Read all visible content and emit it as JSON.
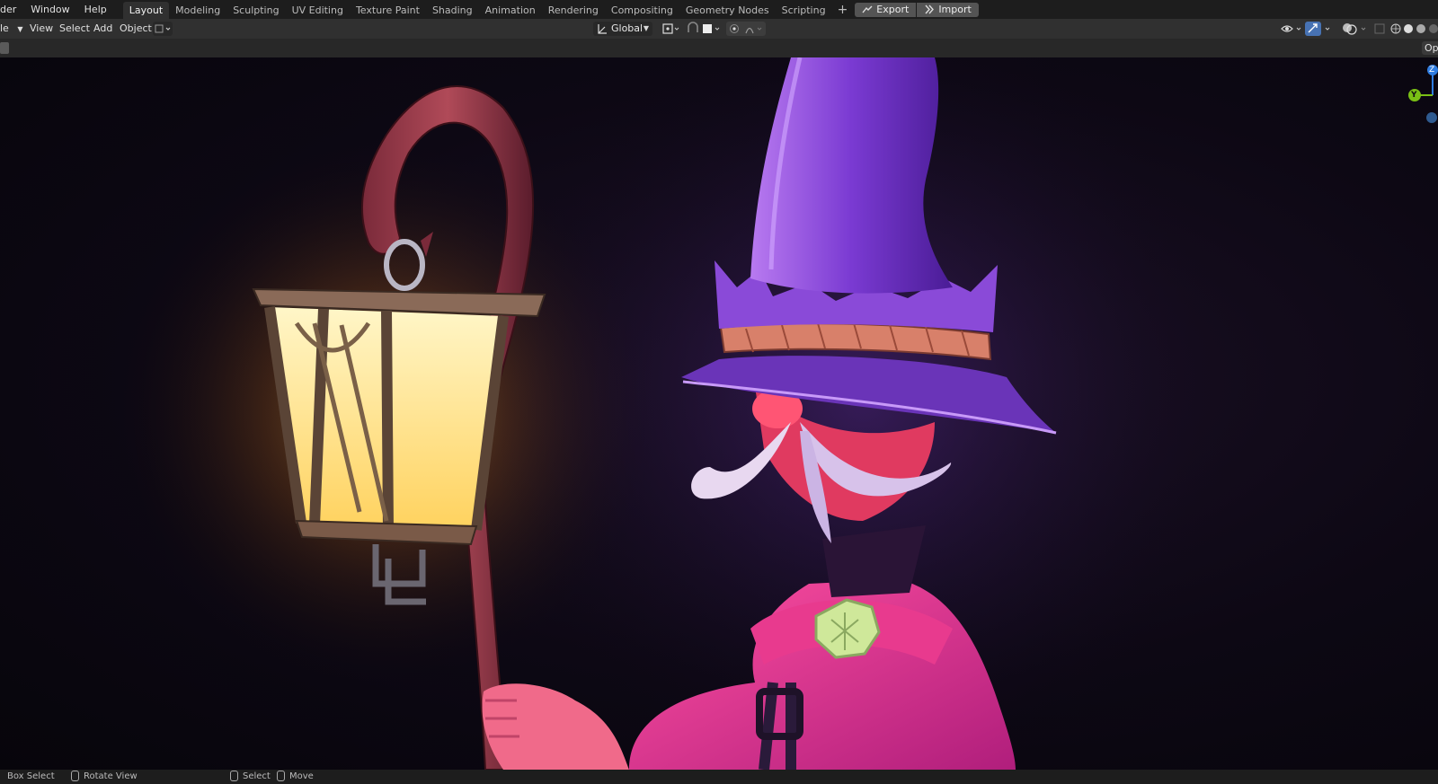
{
  "topbar": {
    "menu": [
      "der",
      "Window",
      "Help"
    ],
    "tabs": [
      "Layout",
      "Modeling",
      "Sculpting",
      "UV Editing",
      "Texture Paint",
      "Shading",
      "Animation",
      "Rendering",
      "Compositing",
      "Geometry Nodes",
      "Scripting"
    ],
    "active_tab": "Layout",
    "plus": "+",
    "export_label": "Export",
    "import_label": "Import"
  },
  "header": {
    "mode_label": "le",
    "view": "View",
    "select": "Select",
    "add": "Add",
    "object": "Object",
    "transform_orientation": "Global"
  },
  "subheader": {
    "options_label": "Opt"
  },
  "gizmo": {
    "z": "Z",
    "y": "Y",
    "z_color": "#2f7ce0",
    "y_color": "#7ac015"
  },
  "statusbar": {
    "box_select": "Box Select",
    "rotate_view": "Rotate View",
    "select": "Select",
    "move": "Move"
  },
  "colors": {
    "topbar_bg": "#1d1d1d",
    "header_bg": "#303030",
    "active_tab_bg": "#303030",
    "lantern_glow": "#ffd36a",
    "hat_purple": "#7a3fd0",
    "robe_magenta": "#e0307e"
  }
}
